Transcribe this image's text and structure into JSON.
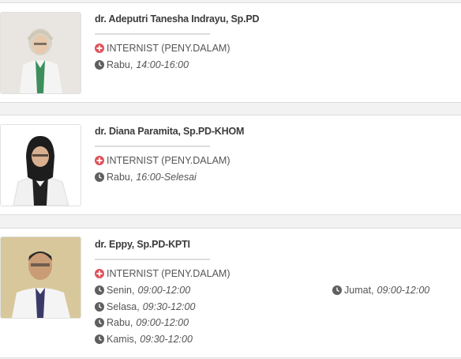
{
  "doctors": [
    {
      "name": "dr. Adeputri Tanesha Indrayu, Sp.PD",
      "specialty": "INTERNIST (PENY.DALAM)",
      "schedule": [
        {
          "day": "Rabu,",
          "time": "14:00-16:00"
        }
      ]
    },
    {
      "name": "dr. Diana Paramita, Sp.PD-KHOM",
      "specialty": "INTERNIST (PENY.DALAM)",
      "schedule": [
        {
          "day": "Rabu,",
          "time": "16:00-Selesai"
        }
      ]
    },
    {
      "name": "dr. Eppy, Sp.PD-KPTI",
      "specialty": "INTERNIST (PENY.DALAM)",
      "schedule": [
        {
          "day": "Senin,",
          "time": "09:00-12:00"
        },
        {
          "day": "Selasa,",
          "time": "09:30-12:00"
        },
        {
          "day": "Rabu,",
          "time": "09:00-12:00"
        },
        {
          "day": "Kamis,",
          "time": "09:30-12:00"
        },
        {
          "day": "Jumat,",
          "time": "09:00-12:00"
        }
      ]
    }
  ],
  "icons": {
    "specialty": "plus-circle-icon",
    "schedule": "clock-icon"
  },
  "colors": {
    "specialty_icon": "#e0525a",
    "clock_icon": "#5f5f5f",
    "card_bg": "#ffffff",
    "page_bg": "#f2f2f2"
  }
}
